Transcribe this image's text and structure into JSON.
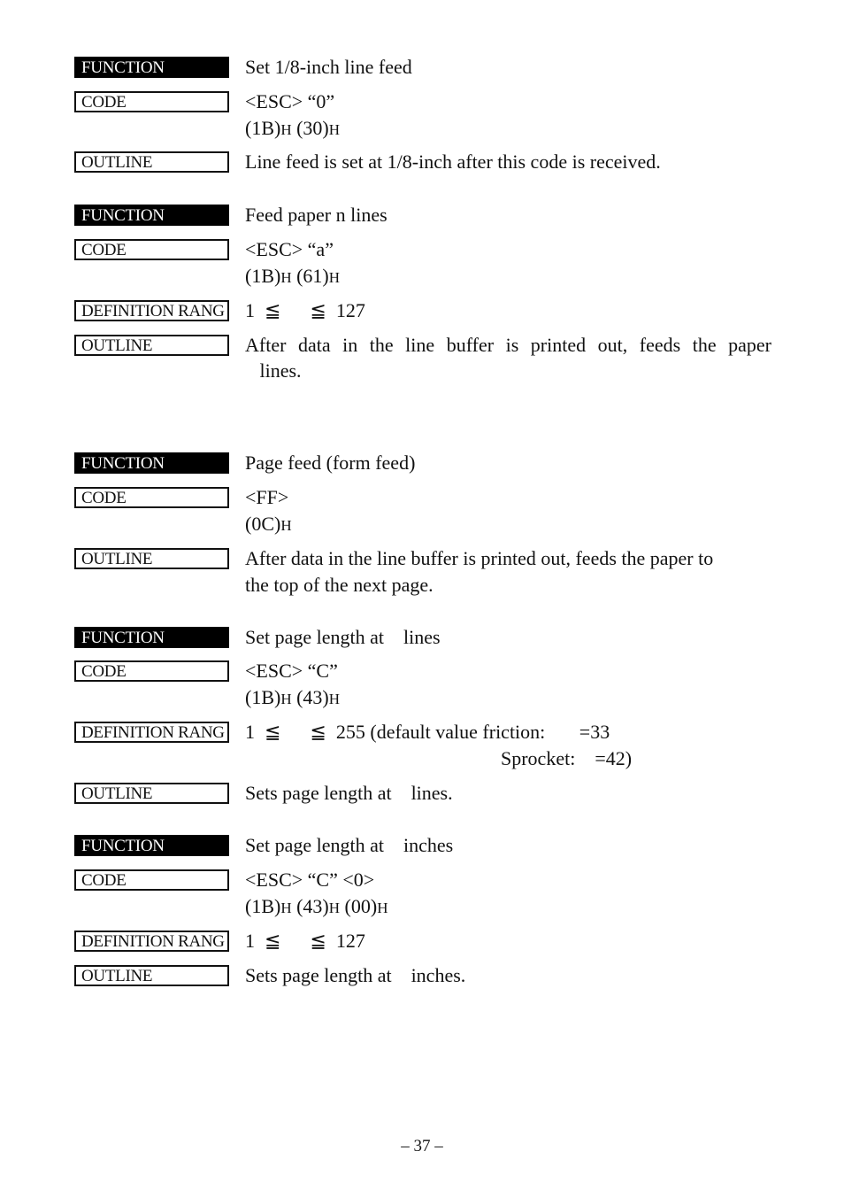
{
  "labels": {
    "function": "FUNCTION",
    "code": "CODE",
    "outline": "OUTLINE",
    "definition_range": "DEFINITION RANG"
  },
  "commands": [
    {
      "function": "Set 1/8-inch line feed",
      "code_line1": "<ESC> “0”",
      "code_line2": [
        {
          "v": "(1B)",
          "h": "H"
        },
        {
          "v": " (30)",
          "h": "H"
        }
      ],
      "outline": "Line feed is set at 1/8-inch after this code is received."
    },
    {
      "function": "Feed paper n lines",
      "code_line1": "<ESC> “a”",
      "code_line2": [
        {
          "v": "(1B)",
          "h": "H"
        },
        {
          "v": " (61)",
          "h": "H"
        }
      ],
      "definition_range": "1  ≦      ≦  127",
      "outline_line1": "After data in the line buffer is printed out, feeds the paper",
      "outline_line2": "   lines."
    },
    {
      "function": "Page feed (form feed)",
      "code_line1": "<FF>",
      "code_line2": [
        {
          "v": "(0C)",
          "h": "H"
        }
      ],
      "outline_line1": "After data in the line buffer is printed out, feeds the paper to",
      "outline_line2": "the top of the next page."
    },
    {
      "function": "Set page length at    lines",
      "code_line1": "<ESC> “C”",
      "code_line2": [
        {
          "v": "(1B)",
          "h": "H"
        },
        {
          "v": " (43)",
          "h": "H"
        }
      ],
      "definition_range_line1": "1  ≦      ≦  255 (default value friction:       =33",
      "definition_range_line2": "Sprocket:    =42)",
      "outline": "Sets page length at    lines."
    },
    {
      "function": "Set page length at    inches",
      "code_line1": "<ESC> “C” <0>",
      "code_line2": [
        {
          "v": "(1B)",
          "h": "H"
        },
        {
          "v": " (43)",
          "h": "H"
        },
        {
          "v": " (00)",
          "h": "H"
        }
      ],
      "definition_range": "1  ≦      ≦  127",
      "outline": "Sets page length at    inches."
    }
  ],
  "page_number": "– 37 –"
}
